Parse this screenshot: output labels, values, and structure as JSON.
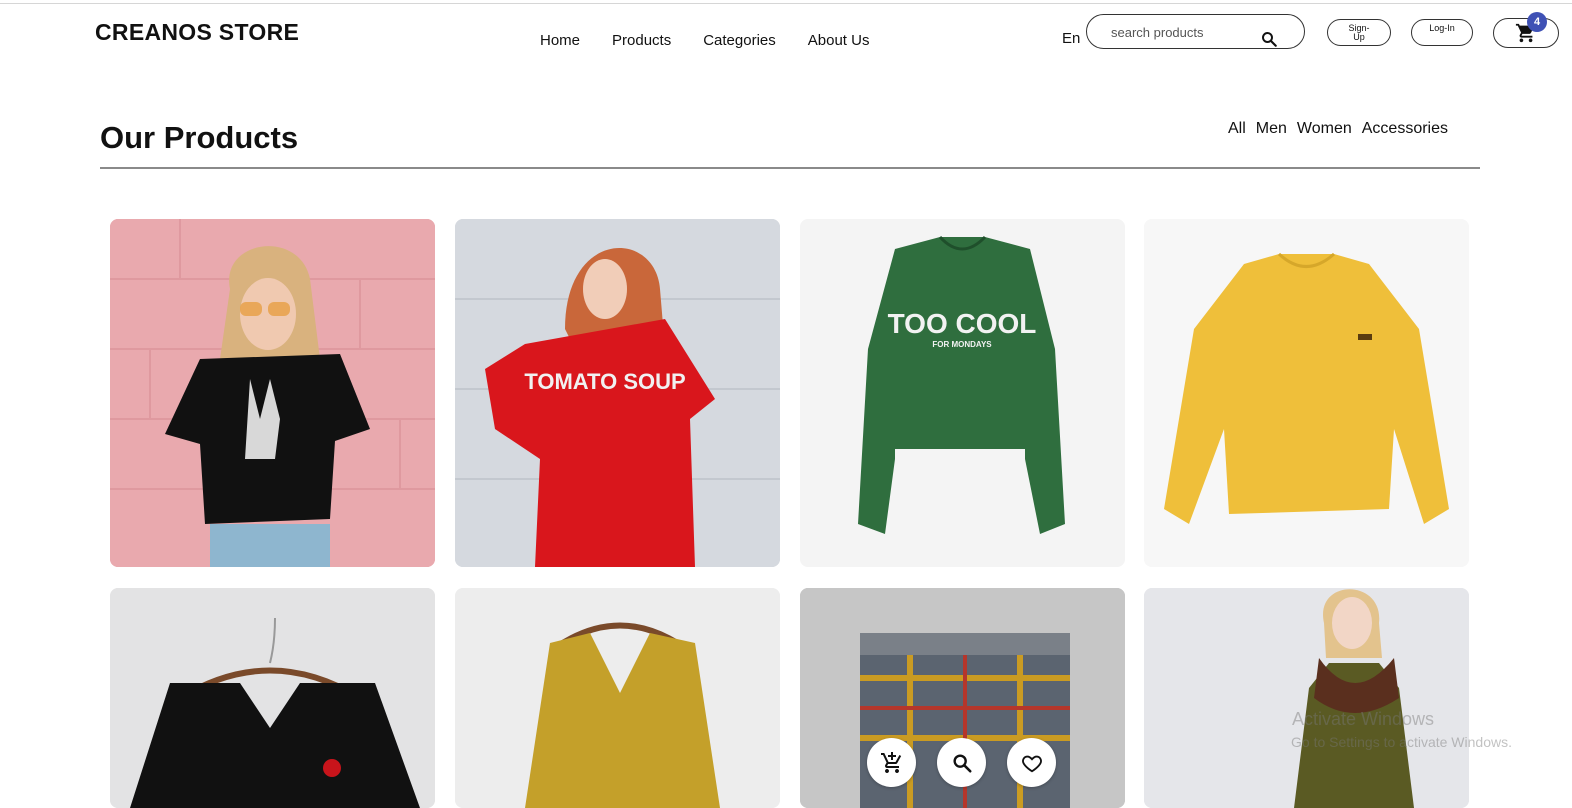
{
  "header": {
    "brand": "CREANOS STORE",
    "nav": [
      "Home",
      "Products",
      "Categories",
      "About Us"
    ],
    "language": "En",
    "search_placeholder": "search products",
    "signup_label": "Sign-Up",
    "login_label": "Log-In",
    "cart_count": "4"
  },
  "products_section": {
    "title": "Our Products",
    "filters": [
      "All",
      "Men",
      "Women",
      "Accessories"
    ]
  },
  "products": [
    {
      "name": "skeleton-hand-tee-photo",
      "print": ""
    },
    {
      "name": "tomato-soup-sweatshirt-photo",
      "print": "TOMATO SOUP"
    },
    {
      "name": "too-cool-sweatshirt-photo",
      "print_main": "TOO COOL",
      "print_sub": "FOR MONDAYS"
    },
    {
      "name": "yellow-knit-sweater-photo",
      "print": ""
    },
    {
      "name": "black-rose-top-photo",
      "print": ""
    },
    {
      "name": "mustard-v-neck-sweater-photo",
      "print": ""
    },
    {
      "name": "plaid-shorts-photo",
      "print": ""
    },
    {
      "name": "olive-fur-collar-coat-photo",
      "print": ""
    }
  ],
  "product_actions": [
    "add-to-cart-icon",
    "search-icon",
    "heart-icon"
  ],
  "watermark": {
    "line1": "Activate Windows",
    "line2": "Go to Settings to activate Windows."
  }
}
